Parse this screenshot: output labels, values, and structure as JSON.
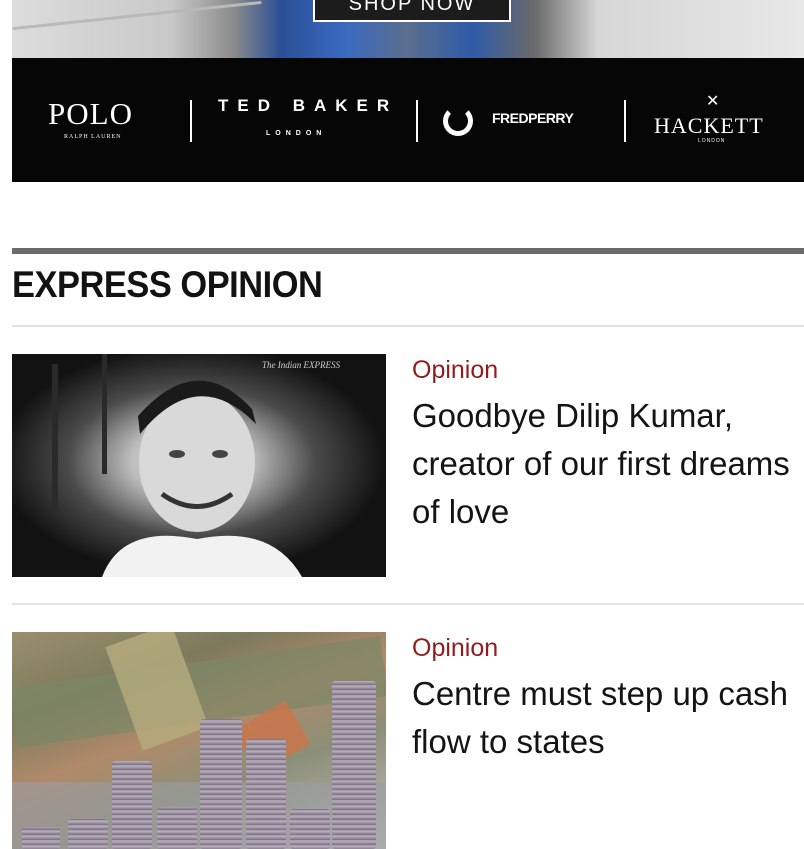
{
  "ad": {
    "cta": "SHOP NOW",
    "brands": [
      {
        "name": "POLO",
        "sub": "RALPH LAUREN"
      },
      {
        "name": "TED BAKER",
        "sub": "LONDON"
      },
      {
        "name": "FREDPERRY"
      },
      {
        "name": "HACKETT",
        "sub": "LONDON"
      }
    ]
  },
  "section": {
    "title": "EXPRESS OPINION"
  },
  "articles": [
    {
      "kicker": "Opinion",
      "headline": "Goodbye Dilip Kumar, creator of our first dreams of love",
      "image_caption": "The Indian EXPRESS"
    },
    {
      "kicker": "Opinion",
      "headline": "Centre must step up cash flow to states"
    }
  ],
  "colors": {
    "kicker": "#8f1d1d",
    "rule": "#6b6b6b",
    "ad_bg": "#060606"
  }
}
